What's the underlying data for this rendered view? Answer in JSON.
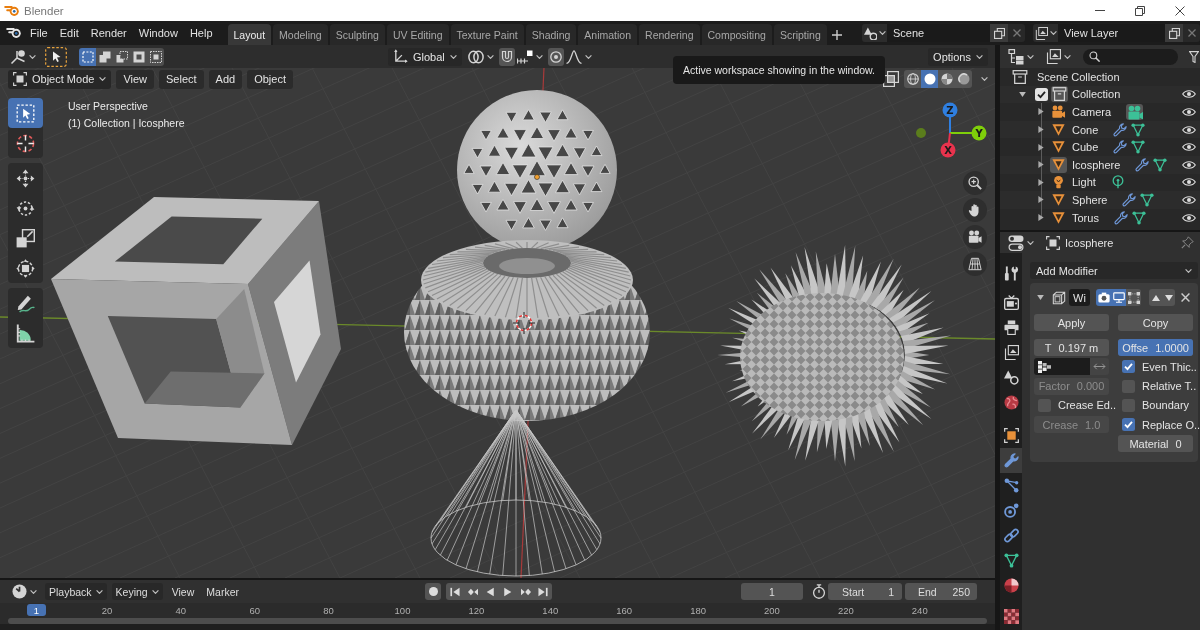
{
  "window": {
    "title": "Blender"
  },
  "menu_bar": {
    "menus": [
      "File",
      "Edit",
      "Render",
      "Window",
      "Help"
    ],
    "workspaces": [
      {
        "label": "Layout",
        "selected": true
      },
      {
        "label": "Modeling",
        "selected": false
      },
      {
        "label": "Sculpting",
        "selected": false
      },
      {
        "label": "UV Editing",
        "selected": false
      },
      {
        "label": "Texture Paint",
        "selected": false
      },
      {
        "label": "Shading",
        "selected": false
      },
      {
        "label": "Animation",
        "selected": false
      },
      {
        "label": "Rendering",
        "selected": false
      },
      {
        "label": "Compositing",
        "selected": false
      },
      {
        "label": "Scripting",
        "selected": false
      }
    ],
    "scene": "Scene",
    "view_layer": "View Layer"
  },
  "viewport": {
    "tool_header": {
      "selection_modes": [
        {
          "kind": "set",
          "selected": true
        },
        {
          "kind": "extend",
          "selected": false
        },
        {
          "kind": "subtract",
          "selected": false
        },
        {
          "kind": "invert",
          "selected": false
        },
        {
          "kind": "intersect",
          "selected": false
        }
      ],
      "orientation": "Global",
      "options": "Options"
    },
    "header": {
      "mode": "Object Mode",
      "menus": [
        "View",
        "Select",
        "Add",
        "Object"
      ],
      "shading": [
        {
          "kind": "wireframe",
          "selected": false
        },
        {
          "kind": "solid",
          "selected": true
        },
        {
          "kind": "material",
          "selected": false
        },
        {
          "kind": "rendered",
          "selected": false
        }
      ]
    },
    "tooltip": "Active workspace showing in the window.",
    "view_name": "User Perspective",
    "view_context": "(1) Collection | Icosphere",
    "tools": [
      {
        "kind": "select_box",
        "selected": true
      },
      {
        "kind": "cursor",
        "selected": false
      },
      {
        "kind": "move",
        "selected": false
      },
      {
        "kind": "rotate",
        "selected": false
      },
      {
        "kind": "scale",
        "selected": false
      },
      {
        "kind": "transform",
        "selected": false
      },
      {
        "kind": "annotate",
        "selected": false
      },
      {
        "kind": "measure",
        "selected": false
      }
    ],
    "gizmo_axes": [
      {
        "label": "Z",
        "color": "#2f7fe0"
      },
      {
        "label": "Y",
        "color": "#7fcf0a"
      },
      {
        "label": "X",
        "color": "#e8334d"
      }
    ]
  },
  "outliner": {
    "root": "Scene Collection",
    "collections": [
      {
        "name": "Collection",
        "checked": true,
        "expanded": true,
        "selected": true,
        "children": [
          {
            "name": "Camera",
            "kind": "camera",
            "modifier": false,
            "selected": false
          },
          {
            "name": "Cone",
            "kind": "mesh",
            "modifier": true,
            "selected": false
          },
          {
            "name": "Cube",
            "kind": "mesh",
            "modifier": true,
            "selected": false
          },
          {
            "name": "Icosphere",
            "kind": "mesh",
            "modifier": true,
            "selected": true
          },
          {
            "name": "Light",
            "kind": "light",
            "modifier": false,
            "selected": false
          },
          {
            "name": "Sphere",
            "kind": "mesh",
            "modifier": true,
            "selected": false
          },
          {
            "name": "Torus",
            "kind": "mesh",
            "modifier": true,
            "selected": false
          }
        ]
      }
    ]
  },
  "properties": {
    "object": "Icosphere",
    "tabs": [
      {
        "kind": "tool",
        "selected": false
      },
      {
        "kind": "render",
        "selected": false
      },
      {
        "kind": "output",
        "selected": false
      },
      {
        "kind": "view_layer",
        "selected": false
      },
      {
        "kind": "scene",
        "selected": false
      },
      {
        "kind": "world",
        "selected": false
      },
      {
        "kind": "object",
        "selected": false
      },
      {
        "kind": "modifier",
        "selected": true
      },
      {
        "kind": "particles",
        "selected": false
      },
      {
        "kind": "physics",
        "selected": false
      },
      {
        "kind": "constraints",
        "selected": false
      },
      {
        "kind": "data",
        "selected": false
      },
      {
        "kind": "material",
        "selected": false
      },
      {
        "kind": "texture",
        "selected": false
      }
    ],
    "add_modifier": "Add Modifier",
    "modifier": {
      "expanded": true,
      "name": "Wi",
      "show_render": true,
      "show_viewport": true,
      "show_editmode": false,
      "apply": "Apply",
      "copy": "Copy",
      "left": [
        {
          "kind": "number",
          "label": "T",
          "value": "0.197 m",
          "disabled": false
        },
        {
          "kind": "vertex_group"
        },
        {
          "kind": "number",
          "label": "Factor",
          "value": "0.000",
          "disabled": true
        },
        {
          "kind": "checkbox",
          "label": "Crease Ed..",
          "checked": false
        },
        {
          "kind": "number",
          "label": "Crease",
          "value": "1.0",
          "disabled": true
        }
      ],
      "right": [
        {
          "kind": "slider",
          "label": "Offse",
          "value": "1.0000",
          "level": 1
        },
        {
          "kind": "checkbox",
          "label": "Even Thic..",
          "checked": true
        },
        {
          "kind": "checkbox",
          "label": "Relative T..",
          "checked": false
        },
        {
          "kind": "checkbox",
          "label": "Boundary",
          "checked": false
        },
        {
          "kind": "checkbox",
          "label": "Replace O..",
          "checked": true
        },
        {
          "kind": "number",
          "label": "Material",
          "value": "0",
          "disabled": false
        }
      ]
    }
  },
  "timeline": {
    "dropdowns": [
      "Playback",
      "Keying"
    ],
    "menus": [
      "View",
      "Marker"
    ],
    "current_frame": "1",
    "start_label": "Start",
    "start": "1",
    "end_label": "End",
    "end": "250",
    "playhead": "1",
    "ruler": [
      "20",
      "40",
      "60",
      "80",
      "100",
      "120",
      "140",
      "160",
      "180",
      "200",
      "220",
      "240"
    ]
  }
}
